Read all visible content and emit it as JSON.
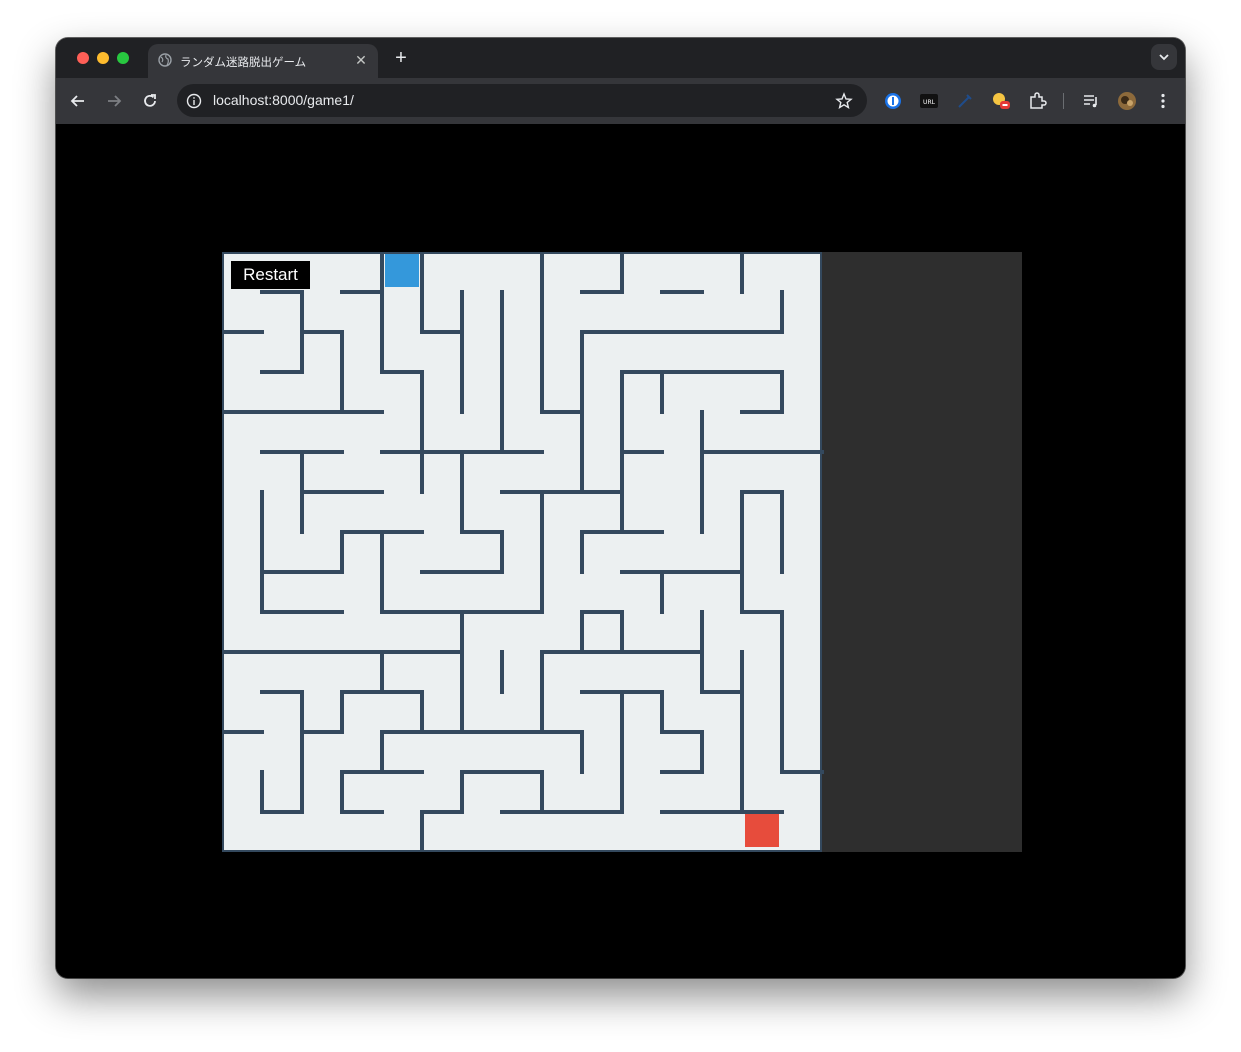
{
  "browser": {
    "tab": {
      "title": "ランダム迷路脱出ゲーム",
      "favicon": "globe-icon"
    },
    "address": {
      "url": "localhost:8000/game1/"
    },
    "colors": {
      "titlebar": "#202124",
      "toolbar": "#35363a"
    }
  },
  "game": {
    "restart_label": "Restart",
    "cols": 15,
    "rows": 15,
    "colors": {
      "floor": "#ecf0f1",
      "wall": "#34495e",
      "player": "#3498db",
      "goal": "#e74c3c",
      "side_panel": "#2e2e2e"
    },
    "player": {
      "col": 4,
      "row": 0
    },
    "goal": {
      "col": 13,
      "row": 14
    },
    "walls": [
      [
        1,
        1,
        2,
        1
      ],
      [
        3,
        1,
        4,
        1
      ],
      [
        9,
        1,
        10,
        1
      ],
      [
        11,
        1,
        12,
        1
      ],
      [
        0,
        2,
        1,
        2
      ],
      [
        2,
        2,
        3,
        2
      ],
      [
        5,
        2,
        6,
        2
      ],
      [
        9,
        2,
        14,
        2
      ],
      [
        1,
        3,
        2,
        3
      ],
      [
        4,
        3,
        5,
        3
      ],
      [
        10,
        3,
        14,
        3
      ],
      [
        0,
        4,
        4,
        4
      ],
      [
        8,
        4,
        9,
        4
      ],
      [
        13,
        4,
        14,
        4
      ],
      [
        1,
        5,
        3,
        5
      ],
      [
        4,
        5,
        8,
        5
      ],
      [
        10,
        5,
        11,
        5
      ],
      [
        12,
        5,
        15,
        5
      ],
      [
        2,
        6,
        4,
        6
      ],
      [
        7,
        6,
        10,
        6
      ],
      [
        13,
        6,
        14,
        6
      ],
      [
        3,
        7,
        5,
        7
      ],
      [
        6,
        7,
        7,
        7
      ],
      [
        9,
        7,
        11,
        7
      ],
      [
        1,
        8,
        3,
        8
      ],
      [
        5,
        8,
        7,
        8
      ],
      [
        10,
        8,
        13,
        8
      ],
      [
        1,
        9,
        3,
        9
      ],
      [
        4,
        9,
        8,
        9
      ],
      [
        9,
        9,
        10,
        9
      ],
      [
        13,
        9,
        14,
        9
      ],
      [
        0,
        10,
        6,
        10
      ],
      [
        8,
        10,
        12,
        10
      ],
      [
        1,
        11,
        2,
        11
      ],
      [
        3,
        11,
        5,
        11
      ],
      [
        9,
        11,
        11,
        11
      ],
      [
        12,
        11,
        13,
        11
      ],
      [
        0,
        12,
        1,
        12
      ],
      [
        2,
        12,
        3,
        12
      ],
      [
        4,
        12,
        9,
        12
      ],
      [
        11,
        12,
        12,
        12
      ],
      [
        3,
        13,
        5,
        13
      ],
      [
        6,
        13,
        8,
        13
      ],
      [
        11,
        13,
        12,
        13
      ],
      [
        14,
        13,
        15,
        13
      ],
      [
        1,
        14,
        2,
        14
      ],
      [
        3,
        14,
        4,
        14
      ],
      [
        5,
        14,
        6,
        14
      ],
      [
        7,
        14,
        10,
        14
      ],
      [
        11,
        14,
        14,
        14
      ],
      [
        2,
        1,
        2,
        3
      ],
      [
        4,
        0,
        4,
        3
      ],
      [
        5,
        0,
        5,
        2
      ],
      [
        6,
        1,
        6,
        4
      ],
      [
        7,
        1,
        7,
        5
      ],
      [
        8,
        0,
        8,
        4
      ],
      [
        10,
        0,
        10,
        1
      ],
      [
        13,
        0,
        13,
        1
      ],
      [
        14,
        1,
        14,
        2
      ],
      [
        3,
        2,
        3,
        4
      ],
      [
        9,
        2,
        9,
        6
      ],
      [
        5,
        3,
        5,
        5
      ],
      [
        10,
        3,
        10,
        6
      ],
      [
        11,
        3,
        11,
        4
      ],
      [
        14,
        3,
        14,
        4
      ],
      [
        12,
        4,
        12,
        7
      ],
      [
        2,
        5,
        2,
        7
      ],
      [
        10,
        6,
        10,
        7
      ],
      [
        1,
        6,
        1,
        9
      ],
      [
        5,
        5,
        5,
        6
      ],
      [
        6,
        5,
        6,
        7
      ],
      [
        8,
        6,
        8,
        9
      ],
      [
        13,
        6,
        13,
        9
      ],
      [
        14,
        6,
        14,
        8
      ],
      [
        3,
        7,
        3,
        8
      ],
      [
        4,
        7,
        4,
        9
      ],
      [
        7,
        7,
        7,
        8
      ],
      [
        9,
        7,
        9,
        8
      ],
      [
        9,
        9,
        9,
        10
      ],
      [
        11,
        8,
        11,
        9
      ],
      [
        12,
        9,
        12,
        11
      ],
      [
        14,
        9,
        14,
        13
      ],
      [
        6,
        9,
        6,
        12
      ],
      [
        10,
        9,
        10,
        10
      ],
      [
        8,
        10,
        8,
        12
      ],
      [
        4,
        10,
        4,
        11
      ],
      [
        7,
        10,
        7,
        11
      ],
      [
        13,
        10,
        13,
        14
      ],
      [
        2,
        11,
        2,
        14
      ],
      [
        3,
        11,
        3,
        12
      ],
      [
        5,
        11,
        5,
        12
      ],
      [
        10,
        11,
        10,
        14
      ],
      [
        11,
        11,
        11,
        12
      ],
      [
        4,
        12,
        4,
        13
      ],
      [
        9,
        12,
        9,
        13
      ],
      [
        12,
        12,
        12,
        13
      ],
      [
        1,
        13,
        1,
        14
      ],
      [
        3,
        13,
        3,
        14
      ],
      [
        6,
        13,
        6,
        14
      ],
      [
        8,
        13,
        8,
        14
      ],
      [
        5,
        14,
        5,
        15
      ]
    ]
  }
}
